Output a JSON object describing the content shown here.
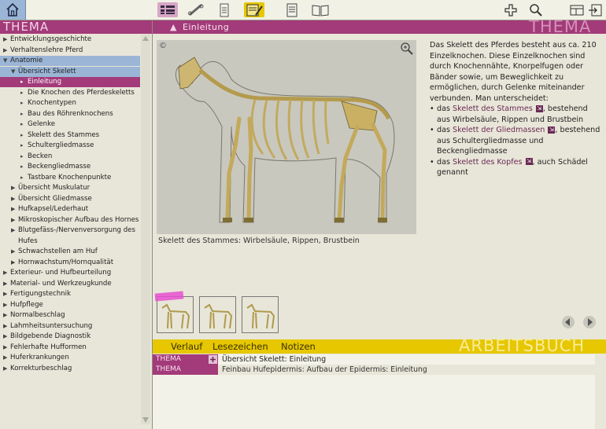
{
  "sidebar": {
    "header": "THEMA",
    "items": [
      {
        "label": "Entwicklungsgeschichte",
        "level": 0,
        "tri": "right"
      },
      {
        "label": "Verhaltenslehre Pferd",
        "level": 0,
        "tri": "right"
      },
      {
        "label": "Anatomie",
        "level": 0,
        "tri": "down"
      },
      {
        "label": "Übersicht Skelett",
        "level": 1,
        "tri": "down"
      },
      {
        "label": "Einleitung",
        "level": 2,
        "tri": "right-small"
      },
      {
        "label": "Die Knochen des Pferdeskeletts",
        "level": 2,
        "tri": "right-small"
      },
      {
        "label": "Knochentypen",
        "level": 2,
        "tri": "right-small"
      },
      {
        "label": "Bau des Röhrenknochens",
        "level": 2,
        "tri": "right-small"
      },
      {
        "label": "Gelenke",
        "level": 2,
        "tri": "right-small"
      },
      {
        "label": "Skelett des Stammes",
        "level": 2,
        "tri": "right-small"
      },
      {
        "label": "Schultergliedmasse",
        "level": 2,
        "tri": "right-small"
      },
      {
        "label": "Becken",
        "level": 2,
        "tri": "right-small"
      },
      {
        "label": "Beckengliedmasse",
        "level": 2,
        "tri": "right-small"
      },
      {
        "label": "Tastbare Knochenpunkte",
        "level": 2,
        "tri": "right-small"
      },
      {
        "label": "Übersicht Muskulatur",
        "level": 1,
        "tri": "right"
      },
      {
        "label": "Übersicht Gliedmasse",
        "level": 1,
        "tri": "right"
      },
      {
        "label": "Hufkapsel/Lederhaut",
        "level": 1,
        "tri": "right"
      },
      {
        "label": "Mikroskopischer Aufbau des Hornes",
        "level": 1,
        "tri": "right"
      },
      {
        "label": "Blutgefäss-/Nervenversorgung des",
        "level": 1,
        "tri": "right"
      },
      {
        "label": "Hufes",
        "level": 1,
        "tri": "none"
      },
      {
        "label": "Schwachstellen am Huf",
        "level": 1,
        "tri": "right"
      },
      {
        "label": "Hornwachstum/Hornqualität",
        "level": 1,
        "tri": "right"
      },
      {
        "label": "Exterieur- und Hufbeurteilung",
        "level": 0,
        "tri": "right"
      },
      {
        "label": "Material- und Werkzeugkunde",
        "level": 0,
        "tri": "right"
      },
      {
        "label": "Fertigungstechnik",
        "level": 0,
        "tri": "right"
      },
      {
        "label": "Hufpflege",
        "level": 0,
        "tri": "right"
      },
      {
        "label": "Normalbeschlag",
        "level": 0,
        "tri": "right"
      },
      {
        "label": "Lahmheitsuntersuchung",
        "level": 0,
        "tri": "right"
      },
      {
        "label": "Bildgebende Diagnostik",
        "level": 0,
        "tri": "right"
      },
      {
        "label": "Fehlerhafte Hufformen",
        "level": 0,
        "tri": "right"
      },
      {
        "label": "Huferkrankungen",
        "level": 0,
        "tri": "right"
      },
      {
        "label": "Korrekturbeschlag",
        "level": 0,
        "tri": "right"
      }
    ]
  },
  "content": {
    "header_title": "Einleitung",
    "watermark": "THEMA",
    "caption": "Skelett des Stammes: Wirbelsäule, Rippen, Brustbein",
    "copyright_symbol": "©",
    "intro": "Das Skelett des Pferdes besteht aus ca. 210 Einzelknochen. Diese Einzelknochen sind durch Knochennähte, Knorpelfugen oder Bänder sowie, um Beweglichkeit zu ermöglichen, durch Gelenke miteinander verbunden. Man unterscheidet:",
    "bullets": [
      {
        "pre": "das ",
        "link": "Skelett des Stammes",
        "post": ", bestehend aus Wirbelsäule, Rippen und Brustbein"
      },
      {
        "pre": "das ",
        "link": "Skelett der Gliedmassen",
        "post": ", bestehend aus Schultergliedmasse und Beckengliedmasse"
      },
      {
        "pre": "das ",
        "link": "Skelett des Kopfes",
        "post": ", auch Schädel genannt"
      }
    ]
  },
  "workbook": {
    "watermark": "ARBEITSBUCH",
    "tabs": [
      "Verlauf",
      "Lesezeichen",
      "Notizen"
    ],
    "rows": [
      {
        "tag": "THEMA",
        "text": "Übersicht Skelett: Einleitung"
      },
      {
        "tag": "THEMA",
        "text": "Feinbau Hufepidermis: Aufbau der Epidermis: Einleitung"
      }
    ]
  },
  "colors": {
    "accent": "#a33a7a",
    "selection": "#9bb5d6",
    "workbook": "#e6c700"
  }
}
